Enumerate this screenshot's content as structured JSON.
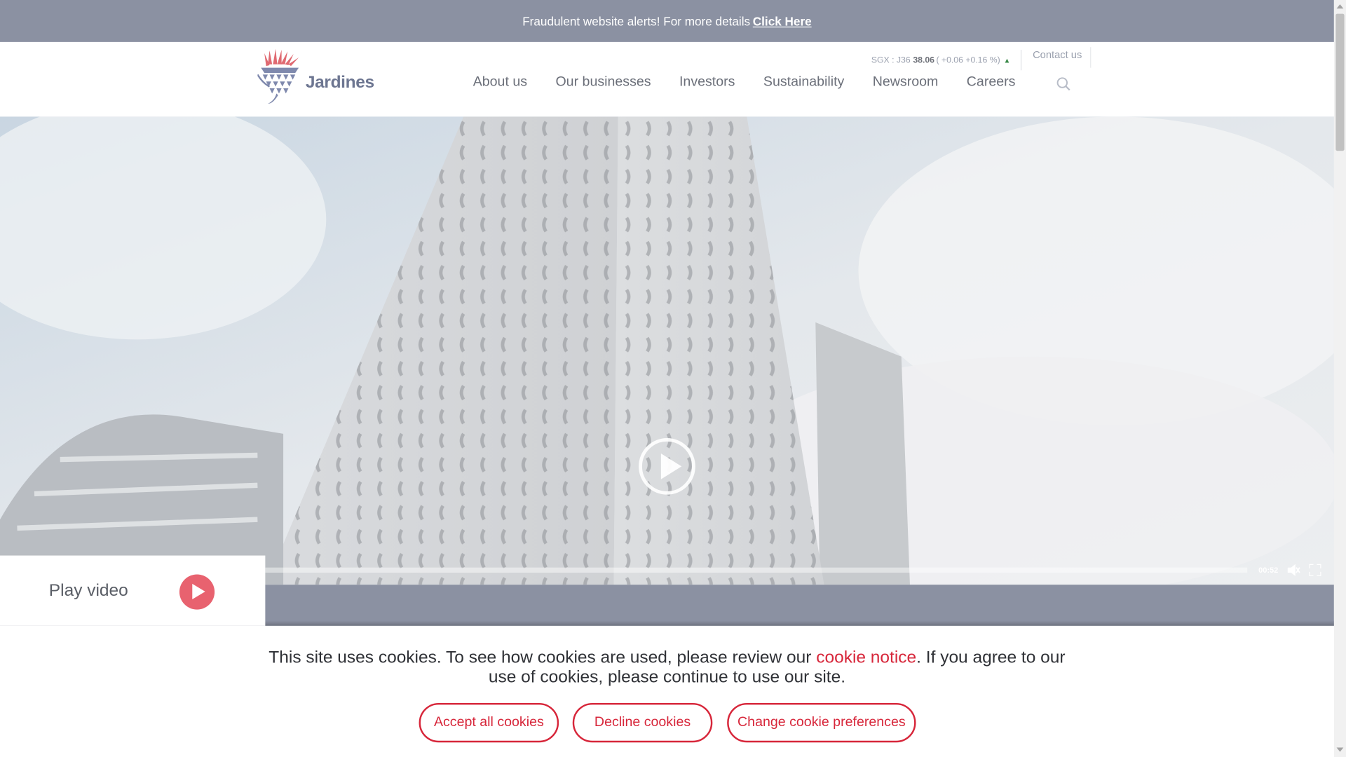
{
  "alert": {
    "text": "Fraudulent website alerts! For more details",
    "link": "Click Here"
  },
  "brand": {
    "name": "Jardines",
    "logo_icon": "thistle-logo"
  },
  "stock": {
    "ticker": "SGX : J36",
    "price": "38.06",
    "change": "( +0.06 +0.16 %)",
    "direction_icon": "triangle-up-icon"
  },
  "header": {
    "contact": "Contact us"
  },
  "nav": [
    {
      "label": "About us"
    },
    {
      "label": "Our businesses"
    },
    {
      "label": "Investors"
    },
    {
      "label": "Sustainability"
    },
    {
      "label": "Newsroom"
    },
    {
      "label": "Careers"
    }
  ],
  "video": {
    "time": "00:52",
    "play_label": "Play video",
    "icons": [
      "play-icon",
      "mute-icon",
      "fullscreen-icon"
    ]
  },
  "cookie": {
    "text_before": "This site uses cookies. To see how cookies are used, please review our ",
    "link": "cookie notice",
    "text_after": ". If you agree to our use of cookies, please continue to use our site.",
    "accept": "Accept all cookies",
    "decline": "Decline cookies",
    "preferences": "Change cookie preferences"
  },
  "colors": {
    "band": "#8b91a2",
    "accent": "#d7263a",
    "play_button": "#e8626f"
  }
}
